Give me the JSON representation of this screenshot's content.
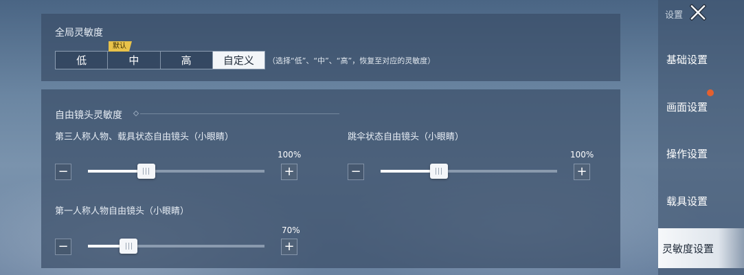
{
  "global_sensitivity": {
    "title": "全局灵敏度",
    "default_badge": "默认",
    "options": [
      "低",
      "中",
      "高",
      "自定义"
    ],
    "selected": "自定义",
    "hint": "（选择“低”、“中”、“高”，恢复至对应的灵敏度）"
  },
  "free_camera": {
    "title": "自由镜头灵敏度",
    "sliders": [
      {
        "label": "第三人称人物、载具状态自由镜头（小眼睛）",
        "value_text": "100%",
        "level": 0.33
      },
      {
        "label": "跳伞状态自由镜头（小眼睛）",
        "value_text": "100%",
        "level": 0.33
      },
      {
        "label": "第一人称人物自由镜头（小眼睛）",
        "value_text": "70%",
        "level": 0.23
      }
    ],
    "minus_glyph": "−",
    "plus_glyph": "+"
  },
  "sidebar": {
    "title": "设置",
    "items": [
      "基础设置",
      "画面设置",
      "操作设置",
      "载具设置",
      "灵敏度设置"
    ],
    "active_index": 4
  },
  "colors": {
    "accent_badge": "#e8c24a",
    "notification_dot": "#e4602f"
  },
  "icons": {
    "close": "close-icon",
    "thumb": "grip-icon"
  }
}
